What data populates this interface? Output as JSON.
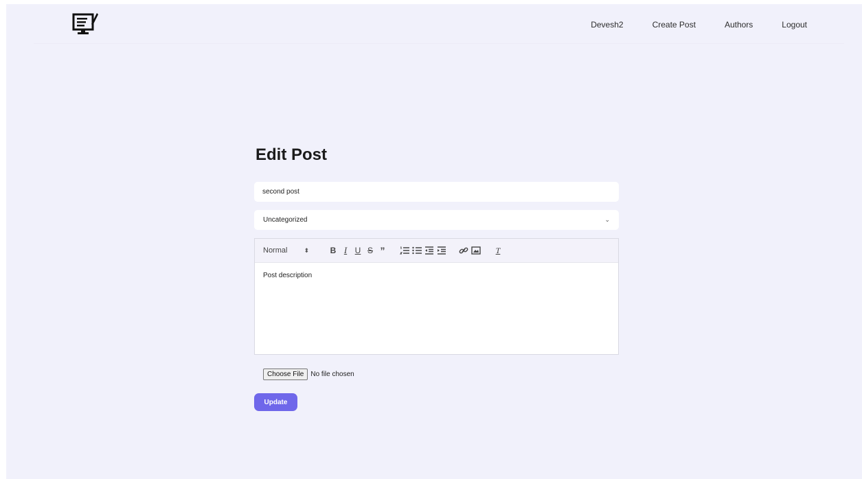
{
  "navbar": {
    "logo_icon": "monitor-edit-icon",
    "links": [
      "Devesh2",
      "Create Post",
      "Authors",
      "Logout"
    ]
  },
  "page": {
    "title": "Edit Post"
  },
  "form": {
    "title_value": "second post",
    "category_selected": "Uncategorized",
    "editor": {
      "heading_select": "Normal",
      "toolbar_icons": [
        "bold-icon",
        "italic-icon",
        "underline-icon",
        "strike-icon",
        "blockquote-icon",
        "ordered-list-icon",
        "bullet-list-icon",
        "indent-decrease-icon",
        "indent-increase-icon",
        "link-icon",
        "image-icon",
        "clear-format-icon"
      ],
      "content": "Post description"
    },
    "file": {
      "button_label": "Choose File",
      "status": "No file chosen"
    },
    "submit_label": "Update"
  },
  "colors": {
    "background": "#f1f1fb",
    "accent": "#6f67ea"
  }
}
